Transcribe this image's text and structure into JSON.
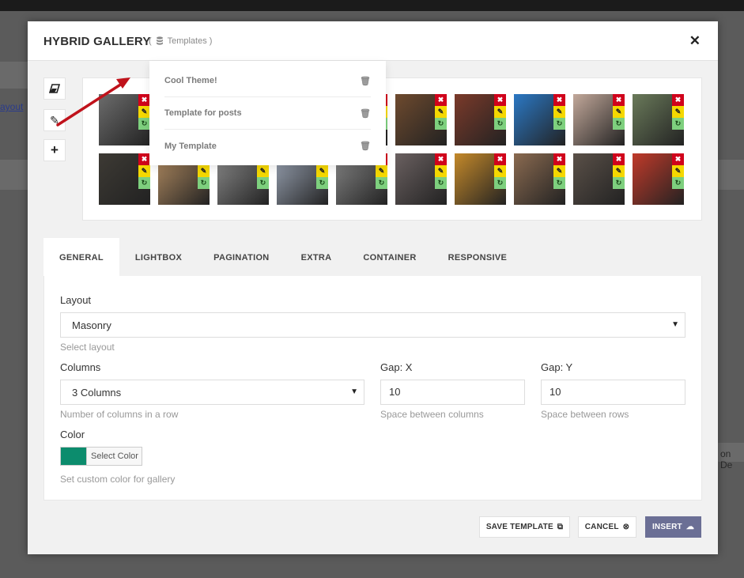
{
  "backdrop": {
    "left_link": "ayout",
    "right_text": "on De"
  },
  "modal": {
    "title": "HYBRID GALLERY",
    "templates_open": "(",
    "templates_label": "Templates",
    "templates_close": ")"
  },
  "tools": [
    {
      "name": "eraser-icon",
      "glyph": "▱"
    },
    {
      "name": "pencil-icon",
      "glyph": "✎"
    },
    {
      "name": "plus-icon",
      "glyph": "+"
    }
  ],
  "templates": [
    {
      "label": "Cool Theme!"
    },
    {
      "label": "Template for posts"
    },
    {
      "label": "My Template"
    }
  ],
  "thumbnails": [
    {
      "color": "#6c6c6c"
    },
    {
      "color": "#8a8a82"
    },
    {
      "color": "#2f2f2f"
    },
    {
      "color": "#7a7060"
    },
    {
      "color": "#3a3028"
    },
    {
      "color": "#6e4a2e"
    },
    {
      "color": "#7b3a2a"
    },
    {
      "color": "#2b78c4"
    },
    {
      "color": "#c2a89a"
    },
    {
      "color": "#6a7a5a"
    },
    {
      "color": "#3d3a34"
    },
    {
      "color": "#b08a60"
    },
    {
      "color": "#8a8a8a"
    },
    {
      "color": "#9aa4b4"
    },
    {
      "color": "#858585"
    },
    {
      "color": "#6a6060"
    },
    {
      "color": "#c4892a"
    },
    {
      "color": "#8a6a50"
    },
    {
      "color": "#5a5048"
    },
    {
      "color": "#c03a2a"
    }
  ],
  "tabs": [
    {
      "label": "GENERAL",
      "active": true
    },
    {
      "label": "LIGHTBOX"
    },
    {
      "label": "PAGINATION"
    },
    {
      "label": "EXTRA"
    },
    {
      "label": "CONTAINER"
    },
    {
      "label": "RESPONSIVE"
    }
  ],
  "general": {
    "layout_label": "Layout",
    "layout_value": "Masonry",
    "layout_help": "Select layout",
    "columns_label": "Columns",
    "columns_value": "3 Columns",
    "columns_help": "Number of columns in a row",
    "gapx_label": "Gap: X",
    "gapx_value": "10",
    "gapx_help": "Space between columns",
    "gapy_label": "Gap: Y",
    "gapy_value": "10",
    "gapy_help": "Space between rows",
    "color_label": "Color",
    "color_value": "#0c8c6d",
    "color_button": "Select Color",
    "color_help": "Set custom color for gallery"
  },
  "footer": {
    "save_template": "SAVE TEMPLATE",
    "cancel": "CANCEL",
    "insert": "INSERT"
  },
  "colors": {
    "accent": "#6b6f95",
    "delete": "#d0021b",
    "edit": "#f5d800",
    "replace": "#7ed07e",
    "arrow": "#c0121b"
  }
}
